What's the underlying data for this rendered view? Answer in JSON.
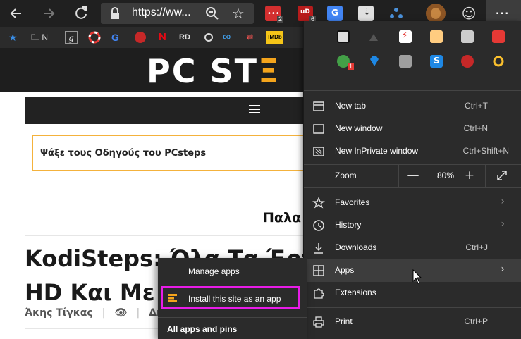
{
  "toolbar": {
    "back_icon": "arrow-left-icon",
    "forward_icon": "arrow-right-icon",
    "refresh_icon": "refresh-icon",
    "address_url": "https://ww...",
    "zoom_icon": "zoom-icon",
    "favorite_star_icon": "star-outline-icon",
    "extensions": [
      {
        "name": "extension-red-dots",
        "badge": "2",
        "color": "#d32f2f"
      },
      {
        "name": "extension-ublock",
        "badge": "6",
        "color": "#b71c1c"
      },
      {
        "name": "extension-translate",
        "badge": "",
        "color": "#4285f4"
      },
      {
        "name": "extension-zip",
        "badge": "",
        "color": "#e0e0e0"
      },
      {
        "name": "extension-network",
        "badge": "",
        "color": "#4a90d9"
      }
    ],
    "profile_icon": "profile-avatar",
    "feedback_icon": "smiley-icon",
    "menu_icon": "ellipsis-icon"
  },
  "favorites_bar": {
    "items": [
      {
        "label": "",
        "icon": "star-icon"
      },
      {
        "label": "N",
        "icon": "folder-icon"
      },
      {
        "label": "",
        "icon": "g-italic-icon"
      },
      {
        "label": "",
        "icon": "lifebuoy-icon"
      },
      {
        "label": "",
        "icon": "google-icon"
      },
      {
        "label": "",
        "icon": "red-globe-icon"
      },
      {
        "label": "",
        "icon": "netflix-icon"
      },
      {
        "label": "RD",
        "icon": "rd-icon"
      },
      {
        "label": "",
        "icon": "circle-icon"
      },
      {
        "label": "",
        "icon": "infinity-icon"
      },
      {
        "label": "",
        "icon": "arrows-icon"
      },
      {
        "label": "",
        "icon": "imdb-icon"
      }
    ]
  },
  "page": {
    "logo_main": "PC ST",
    "logo_accent": "Ξ",
    "search_prompt": "Ψάξε τους Οδηγούς του PCsteps",
    "section_title": "Παλα",
    "article_title": "KodiSteps: Όλα Τα Έργα\nHD Και Με Ε",
    "byline_author": "Άκης Τίγκας",
    "byline_views_icon": "eye-icon",
    "byline_category": "Δημοσ"
  },
  "menu": {
    "extension_grid": [
      {
        "name": "ext-window",
        "color": "#111111"
      },
      {
        "name": "ext-mountain",
        "color": "#555555"
      },
      {
        "name": "ext-pdf",
        "color": "#e53935"
      },
      {
        "name": "ext-face",
        "color": "#ffcc80"
      },
      {
        "name": "ext-page",
        "color": "#cccccc"
      },
      {
        "name": "ext-redbox",
        "color": "#e53935"
      },
      {
        "name": "ext-green-circle",
        "color": "#43a047"
      },
      {
        "name": "ext-diamond",
        "color": "#1e88e5"
      },
      {
        "name": "ext-search",
        "color": "#9e9e9e"
      },
      {
        "name": "ext-s",
        "color": "#1e88e5"
      },
      {
        "name": "ext-red-tools",
        "color": "#c62828"
      },
      {
        "name": "ext-yellow-circle",
        "color": "#fbc02d"
      }
    ],
    "extension_grid_badge": "1",
    "new_tab": {
      "label": "New tab",
      "shortcut": "Ctrl+T"
    },
    "new_window": {
      "label": "New window",
      "shortcut": "Ctrl+N"
    },
    "new_inprivate": {
      "label": "New InPrivate window",
      "shortcut": "Ctrl+Shift+N"
    },
    "zoom": {
      "label": "Zoom",
      "value": "80%",
      "minus": "—",
      "plus": "+"
    },
    "favorites": {
      "label": "Favorites"
    },
    "history": {
      "label": "History"
    },
    "downloads": {
      "label": "Downloads",
      "shortcut": "Ctrl+J"
    },
    "apps": {
      "label": "Apps"
    },
    "extensions": {
      "label": "Extensions"
    },
    "print": {
      "label": "Print",
      "shortcut": "Ctrl+P"
    }
  },
  "apps_submenu": {
    "manage_apps": "Manage apps",
    "install_site": "Install this site as an app",
    "all_apps_header": "All apps and pins",
    "highlight_color": "#e81ce8"
  },
  "colors": {
    "toolbar_bg": "#202020",
    "menu_bg": "#2b2b2b",
    "logo_accent": "#f4a41c"
  }
}
